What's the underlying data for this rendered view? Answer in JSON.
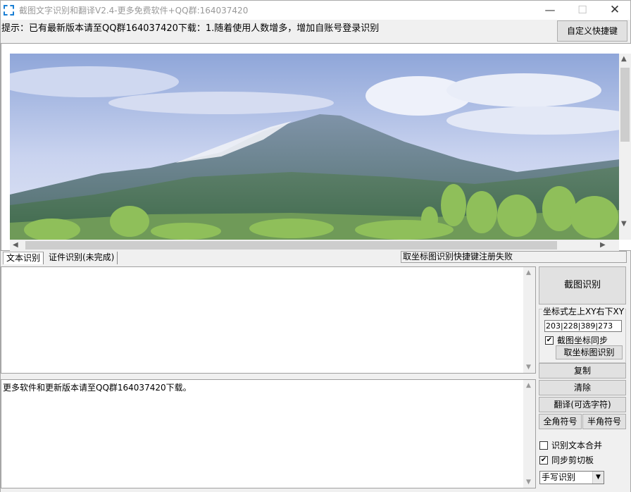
{
  "window": {
    "title": "截图文字识别和翻译V2.4-更多免费软件+QQ群:164037420",
    "minimize": "—",
    "maximize": "☐",
    "close": "✕"
  },
  "tip": {
    "text": "提示：已有最新版本请至QQ群164037420下载：1.随着使用人数增多，增加自账号登录识别"
  },
  "toolbar": {
    "shortcut_label": "自定义快捷键"
  },
  "tabs": [
    {
      "label": "文本识别"
    },
    {
      "label": "证件识别(未完成)"
    }
  ],
  "status": {
    "message": "取坐标图识别快捷键注册失败"
  },
  "text_output": {
    "recognized": "",
    "result": "更多软件和更新版本请至QQ群164037420下载。"
  },
  "right_panel": {
    "ocr_label": "截图识别",
    "coords_group_title": "坐标式左上XY右下XY",
    "coords_value": "203|228|389|273",
    "sync_coords_label": "截图坐标同步",
    "sync_coords_checked": true,
    "coord_ocr_label": "取坐标图识别",
    "copy_label": "复制",
    "clear_label": "清除",
    "translate_label": "翻译(可选字符)",
    "fullwidth_label": "全角符号",
    "halfwidth_label": "半角符号",
    "merge_text_label": "识别文本合并",
    "merge_text_checked": false,
    "sync_clipboard_label": "同步剪切板",
    "sync_clipboard_checked": true,
    "mode_value": "手写识别"
  },
  "icons": {
    "scroll_up": "▲",
    "scroll_down": "▼",
    "scroll_left": "◀",
    "scroll_right": "▶",
    "check": "✔",
    "dropdown": "▼"
  }
}
